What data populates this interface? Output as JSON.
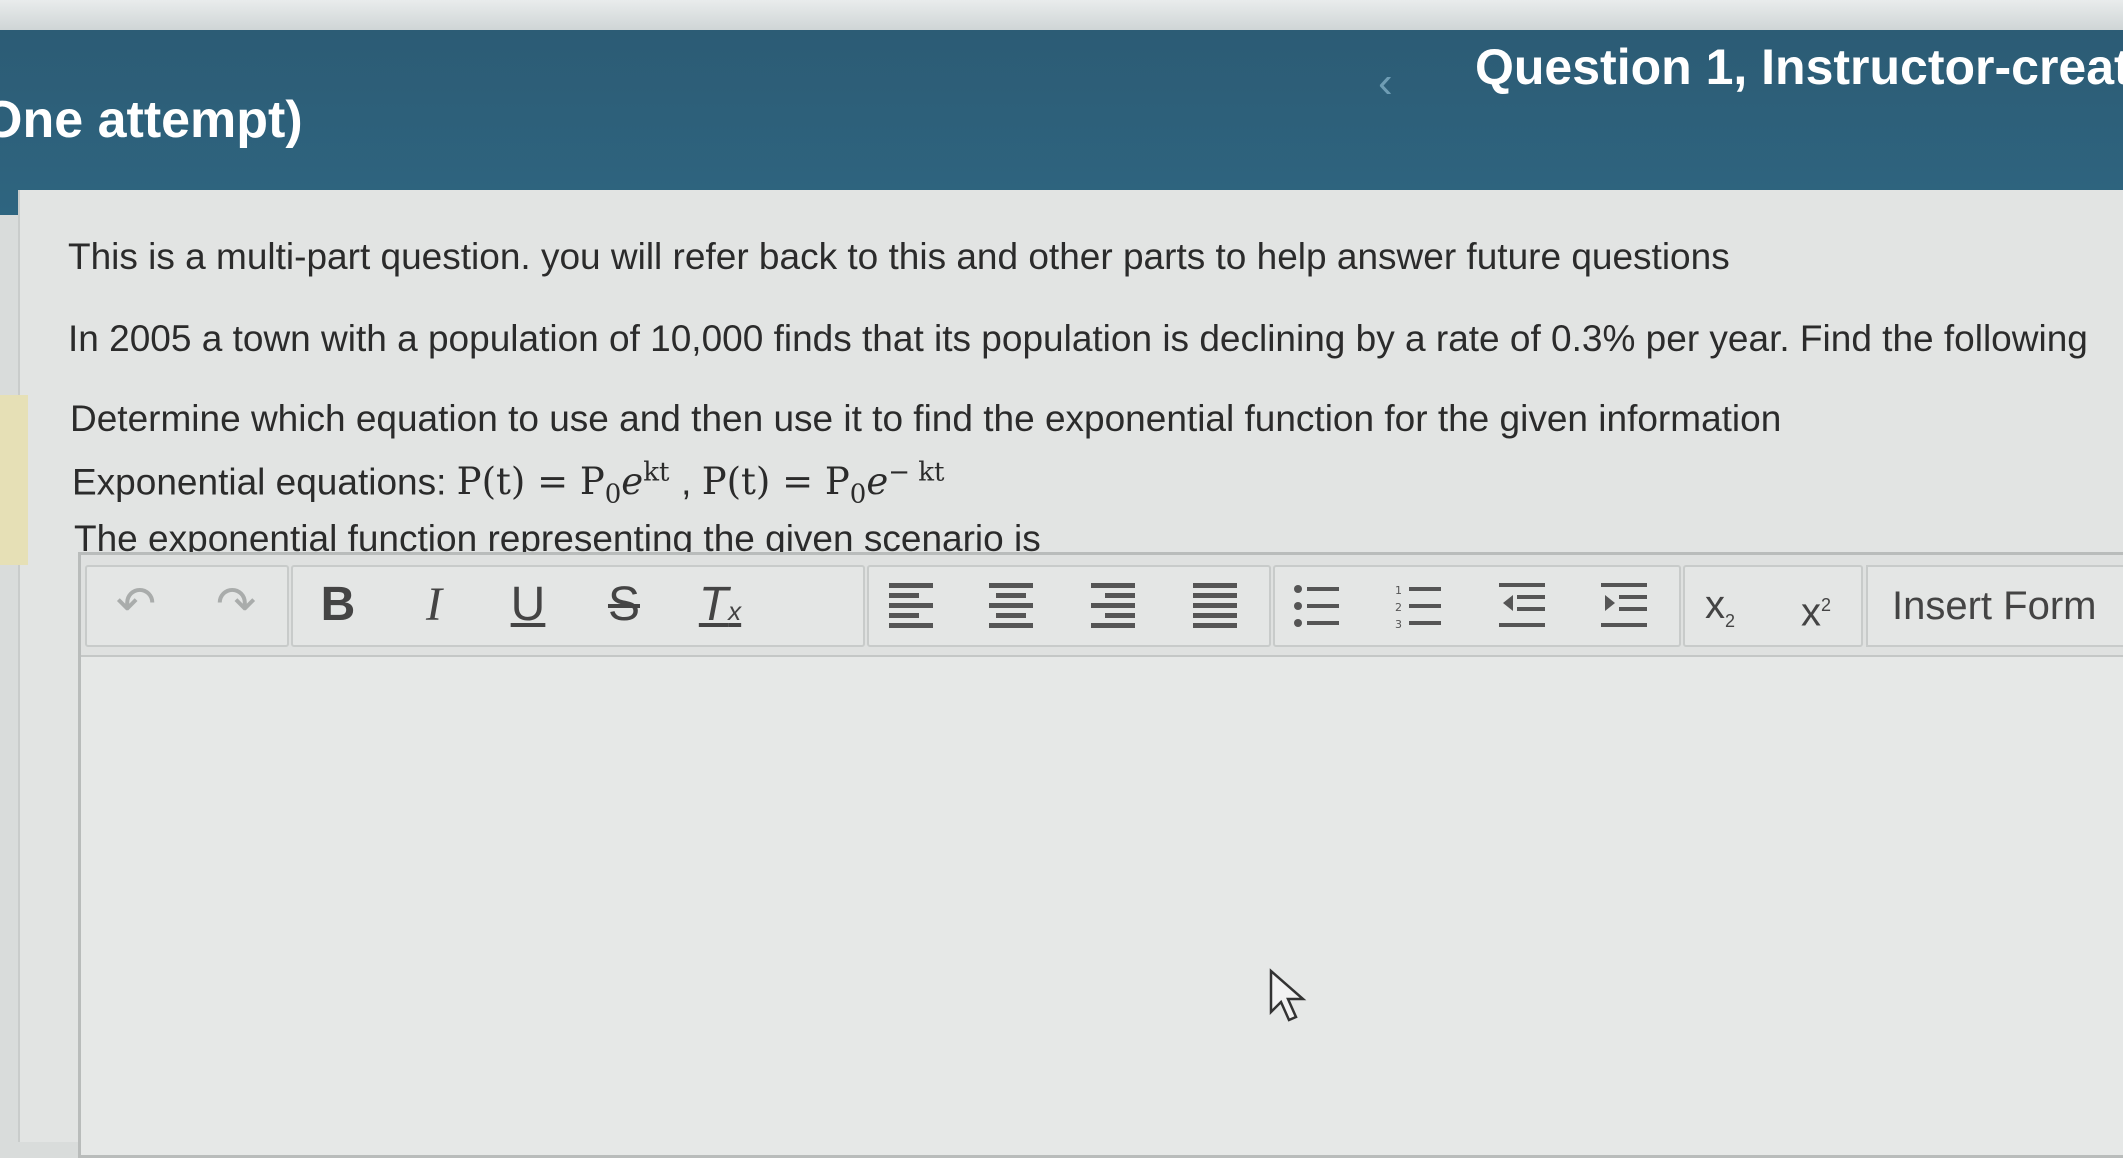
{
  "header": {
    "attempt_label": "One attempt)",
    "back_icon": "chevron-left-icon",
    "question_title": "Question 1, Instructor-creat"
  },
  "question": {
    "line1": "This is a multi-part question. you will refer back to this and other parts to help answer future questions",
    "line2": "In 2005 a town with a population of 10,000 finds that its population is declining by a rate of 0.3% per year.  Find the following",
    "line3": "Determine which equation to use and then use it to find the exponential function for the given information",
    "equations_label": "Exponential equations:",
    "eq1_lhs": "P(t) = P",
    "eq1_sub": "0",
    "eq1_base": "e",
    "eq1_exp": "kt",
    "separator": ",",
    "eq2_lhs": "P(t) = P",
    "eq2_sub": "0",
    "eq2_base": "e",
    "eq2_exp": "− kt",
    "line5": "The exponential function representing the given scenario is"
  },
  "toolbar": {
    "undo_icon": "undo-icon",
    "redo_icon": "redo-icon",
    "bold": "B",
    "italic": "I",
    "underline": "U",
    "strike": "S",
    "clear_format": "T",
    "clear_format_sub": "x",
    "subscript_base": "x",
    "subscript_mark": "2",
    "superscript_base": "x",
    "superscript_mark": "2",
    "insert_formula": "Insert Form"
  },
  "colors": {
    "header_bg": "#2c5a73",
    "content_bg": "#e2e4e3",
    "text": "#2b2b2b"
  }
}
